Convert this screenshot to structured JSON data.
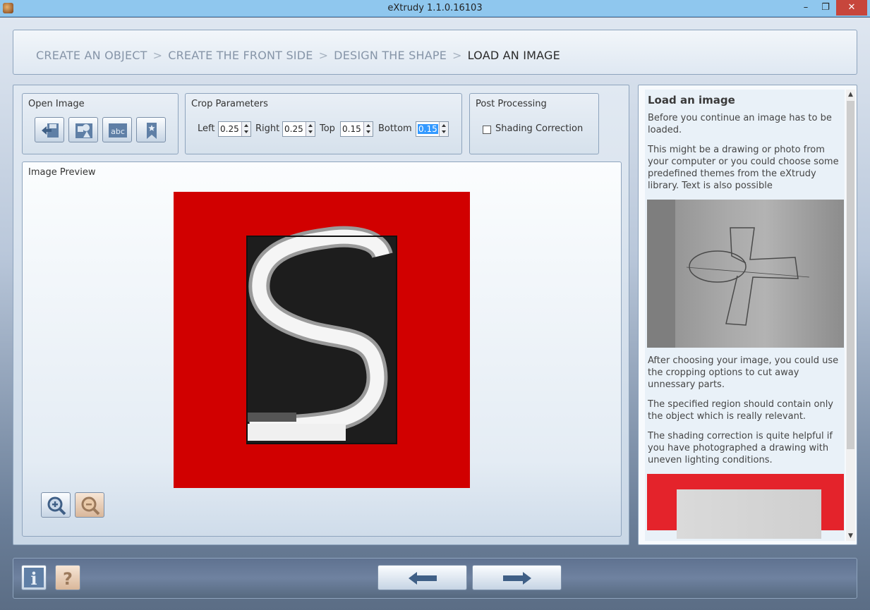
{
  "window": {
    "title": "eXtrudy 1.1.0.16103",
    "minimize_glyph": "–",
    "maximize_glyph": "❐",
    "close_glyph": "✕"
  },
  "breadcrumb": {
    "steps": [
      "CREATE AN OBJECT",
      "CREATE THE FRONT SIDE",
      "DESIGN THE SHAPE",
      "LOAD AN IMAGE"
    ],
    "separator": ">",
    "current_index": 3
  },
  "open_image": {
    "title": "Open Image",
    "tools": [
      {
        "icon": "open-file-icon"
      },
      {
        "icon": "shapes-icon"
      },
      {
        "icon": "text-abc-icon",
        "label": "abc"
      },
      {
        "icon": "bookmark-star-icon"
      }
    ]
  },
  "crop": {
    "title": "Crop Parameters",
    "left_label": "Left",
    "left_value": "0.25",
    "right_label": "Right",
    "right_value": "0.25",
    "top_label": "Top",
    "top_value": "0.15",
    "bottom_label": "Bottom",
    "bottom_value": "0.15"
  },
  "post": {
    "title": "Post Processing",
    "shading_label": "Shading Correction",
    "shading_checked": false
  },
  "preview": {
    "title": "Image Preview",
    "zoom_in_icon": "zoom-in-icon",
    "zoom_out_icon": "zoom-out-icon"
  },
  "help": {
    "heading": "Load an image",
    "p1": "Before you continue an image has to be loaded.",
    "p2": "This might be a drawing or photo from your computer or you could choose some predefined themes from the eXtrudy library. Text is also possible",
    "p3": "After choosing your image, you could use the cropping options to cut away unnessary parts.",
    "p4": "The specified region should contain only the object which is really relevant.",
    "p5": "The shading correction is quite helpful if you have photographed a drawing with uneven lighting conditions."
  },
  "bottom": {
    "info_icon": "info-icon",
    "info_label": "i",
    "help_icon": "help-icon",
    "help_label": "?",
    "back_icon": "arrow-left-icon",
    "next_icon": "arrow-right-icon"
  },
  "colors": {
    "canvas_bg": "#d10000",
    "accent": "#3399ff",
    "titlebar": "#8fc7ee",
    "close_button": "#c7463c"
  }
}
